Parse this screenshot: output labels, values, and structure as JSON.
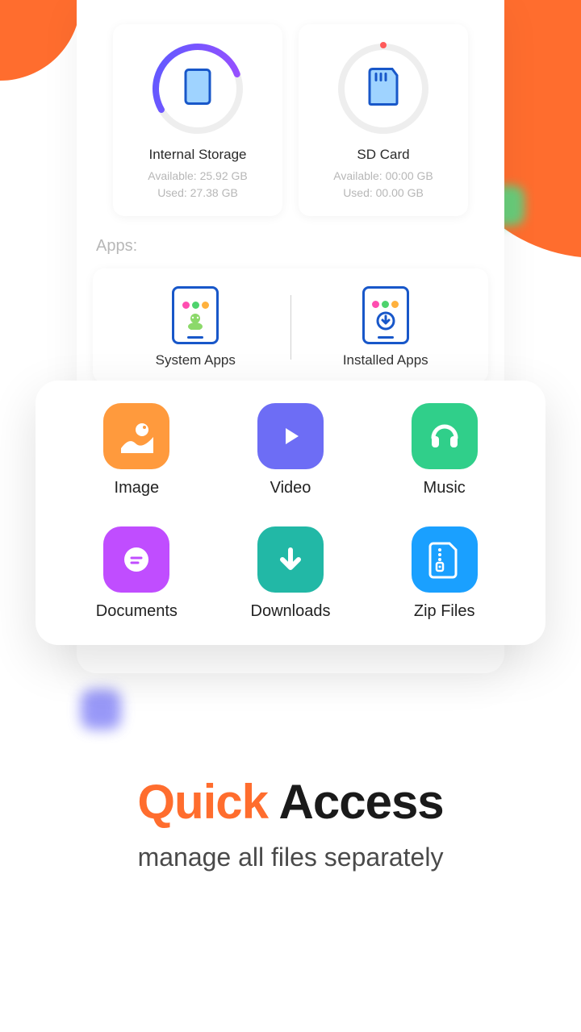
{
  "storage": {
    "internal": {
      "title": "Internal Storage",
      "available": "Available: 25.92 GB",
      "used": "Used: 27.38 GB"
    },
    "sd": {
      "title": "SD Card",
      "available": "Available: 00:00 GB",
      "used": "Used: 00.00 GB"
    }
  },
  "apps": {
    "section_label": "Apps:",
    "system": "System Apps",
    "installed": "Installed Apps"
  },
  "quick_access": {
    "image": "Image",
    "video": "Video",
    "music": "Music",
    "documents": "Documents",
    "downloads": "Downloads",
    "zip": "Zip Files"
  },
  "headline": {
    "word1": "Quick",
    "word2": "Access",
    "sub": "manage all files separately"
  },
  "colors": {
    "orange": "#ff6d2e",
    "purple": "#6d6df5",
    "green": "#30cf8a",
    "teal": "#22b8a6",
    "blue": "#1aa0ff",
    "magenta": "#c04dff"
  }
}
